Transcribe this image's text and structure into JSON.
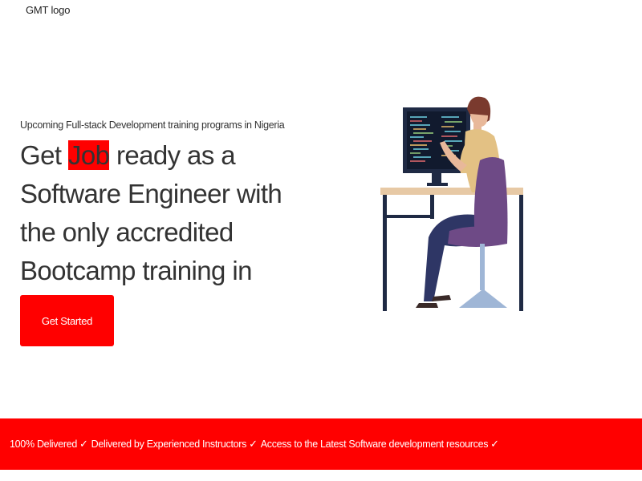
{
  "logo": {
    "alt": "GMT logo"
  },
  "hero": {
    "subtitle": "Upcoming Full-stack Development training programs in Nigeria",
    "headline_prefix": "Get ",
    "headline_highlight": "Job",
    "headline_rest": " ready as a Software Engineer with the only accredited Bootcamp training in Nigeria.",
    "cta_label": "Get Started"
  },
  "illustration": {
    "icon": "developer-at-desk-illustration"
  },
  "banner": {
    "features": [
      {
        "label": "100% Delivered",
        "check": "✓"
      },
      {
        "label": "Delivered by Experienced Instructors",
        "check": "✓"
      },
      {
        "label": "Access to the Latest Software development resources",
        "check": "✓"
      }
    ]
  },
  "colors": {
    "accent": "#ff0000",
    "text": "#333333",
    "background": "#ffffff"
  }
}
